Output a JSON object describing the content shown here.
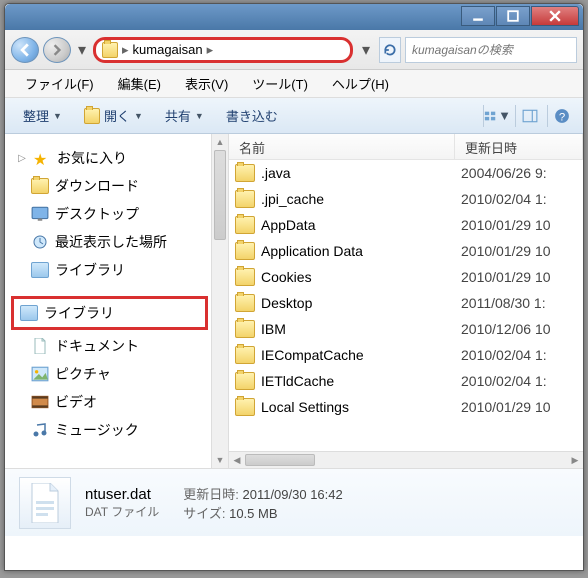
{
  "breadcrumb": {
    "folder": "kumagaisan"
  },
  "search": {
    "placeholder": "kumagaisanの検索"
  },
  "menu": {
    "file": "ファイル(F)",
    "edit": "編集(E)",
    "view": "表示(V)",
    "tools": "ツール(T)",
    "help": "ヘルプ(H)"
  },
  "toolbar": {
    "organize": "整理",
    "open": "開く",
    "share": "共有",
    "burn": "書き込む"
  },
  "sidebar": {
    "favorites": "お気に入り",
    "downloads": "ダウンロード",
    "desktop": "デスクトップ",
    "recent": "最近表示した場所",
    "library1": "ライブラリ",
    "library2": "ライブラリ",
    "documents": "ドキュメント",
    "pictures": "ピクチャ",
    "videos": "ビデオ",
    "music": "ミュージック"
  },
  "columns": {
    "name": "名前",
    "modified": "更新日時"
  },
  "files": [
    {
      "name": ".java",
      "date": "2004/06/26 9:"
    },
    {
      "name": ".jpi_cache",
      "date": "2010/02/04 1:"
    },
    {
      "name": "AppData",
      "date": "2010/01/29 10"
    },
    {
      "name": "Application Data",
      "date": "2010/01/29 10"
    },
    {
      "name": "Cookies",
      "date": "2010/01/29 10"
    },
    {
      "name": "Desktop",
      "date": "2011/08/30 1:"
    },
    {
      "name": "IBM",
      "date": "2010/12/06 10"
    },
    {
      "name": "IECompatCache",
      "date": "2010/02/04 1:"
    },
    {
      "name": "IETldCache",
      "date": "2010/02/04 1:"
    },
    {
      "name": "Local Settings",
      "date": "2010/01/29 10"
    }
  ],
  "details": {
    "filename": "ntuser.dat",
    "filetype": "DAT ファイル",
    "modified_label": "更新日時:",
    "modified_value": "2011/09/30 16:42",
    "size_label": "サイズ:",
    "size_value": "10.5 MB"
  }
}
